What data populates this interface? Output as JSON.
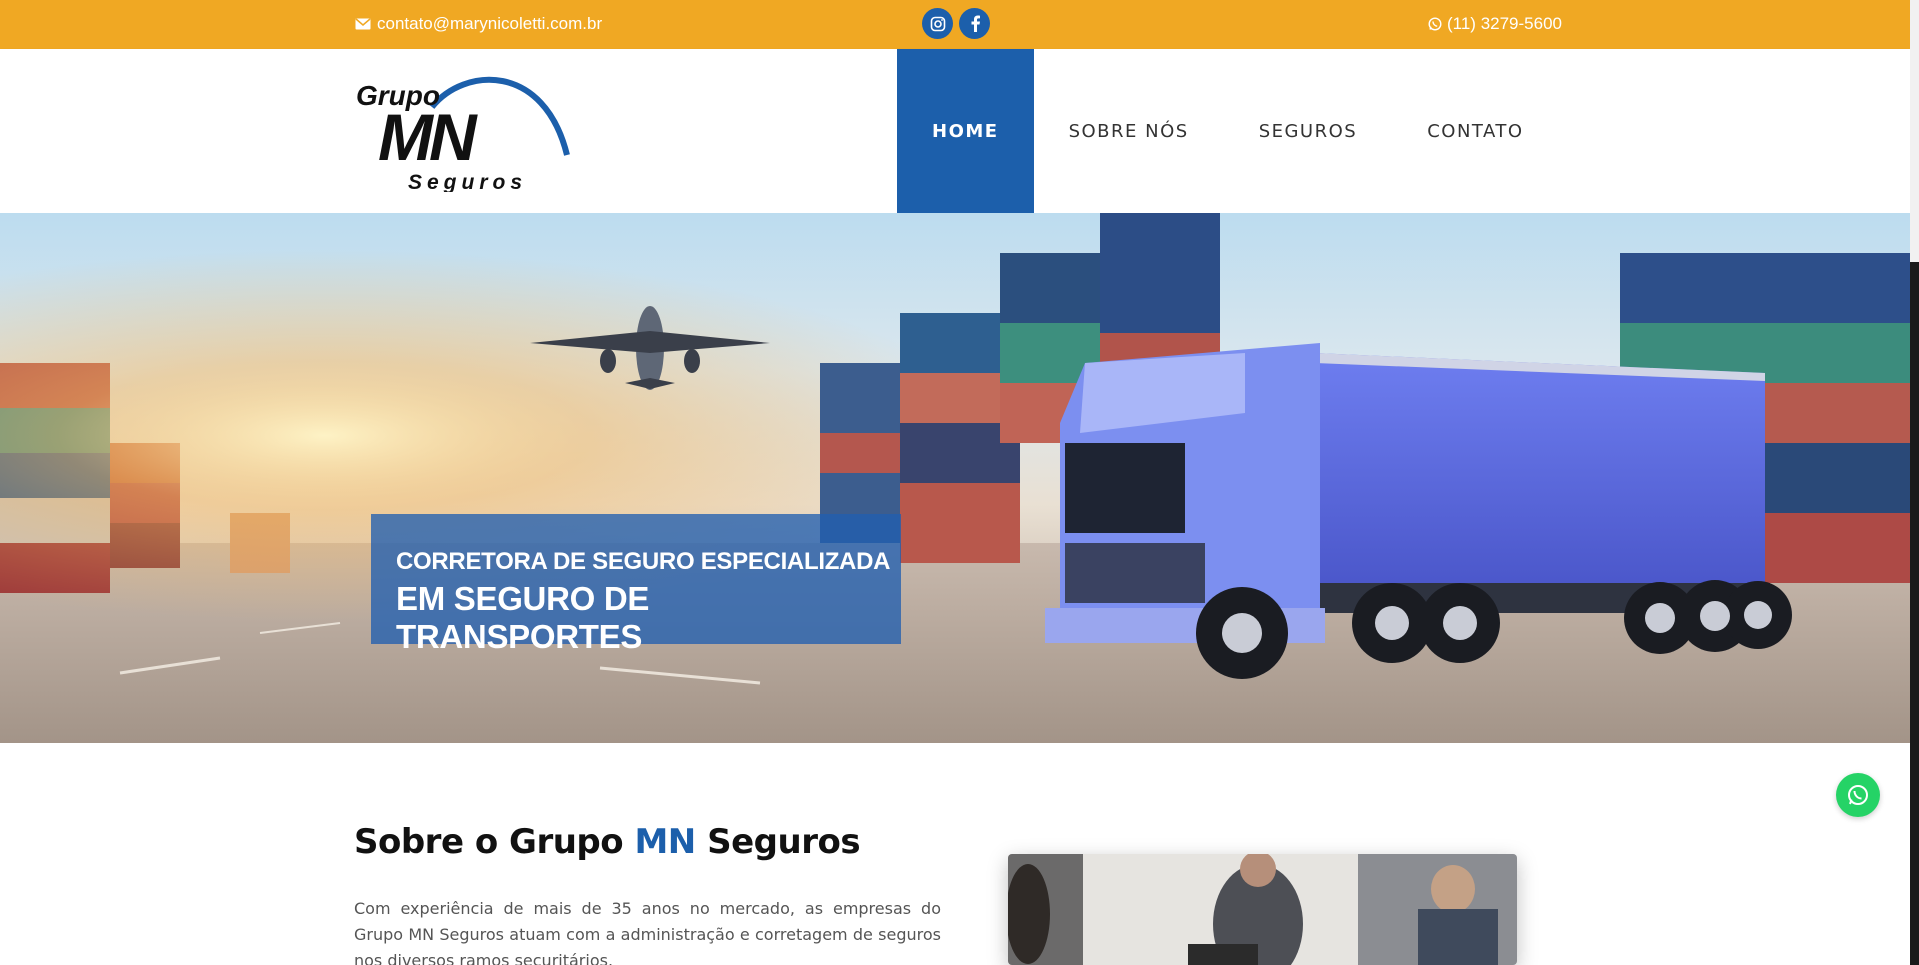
{
  "topbar": {
    "email": "contato@marynicoletti.com.br",
    "email_icon": "envelope-icon",
    "social": [
      {
        "name": "instagram-icon"
      },
      {
        "name": "facebook-icon"
      }
    ],
    "phone": "(11) 3279-5600",
    "phone_icon": "whatsapp-icon"
  },
  "logo": {
    "line1": "Grupo",
    "line2": "MN",
    "line3": "Seguros"
  },
  "nav": {
    "items": [
      {
        "label": "HOME",
        "active": true
      },
      {
        "label": "SOBRE NÓS",
        "active": false
      },
      {
        "label": "SEGUROS",
        "active": false
      },
      {
        "label": "CONTATO",
        "active": false
      }
    ]
  },
  "hero": {
    "line1": "CORRETORA DE SEGURO ESPECIALIZADA",
    "line2": "EM SEGURO DE TRANSPORTES"
  },
  "about": {
    "title_part1": "Sobre o Grupo ",
    "title_accent": "MN",
    "title_part2": " Seguros",
    "text": "Com experiência de mais de 35 anos no mercado, as empresas do Grupo MN Seguros atuam com a administração e corretagem de seguros nos diversos ramos securitários."
  },
  "colors": {
    "topbar": "#f0a823",
    "brand_blue": "#1c5fab",
    "whatsapp": "#25d366"
  }
}
